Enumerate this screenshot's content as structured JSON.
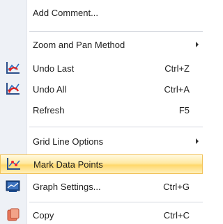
{
  "menu": {
    "items": [
      {
        "label": "Add Comment...",
        "shortcut": "",
        "submenu": false,
        "icon": ""
      },
      {
        "label": "Zoom and Pan Method",
        "shortcut": "",
        "submenu": true,
        "icon": ""
      },
      {
        "label": "Undo Last",
        "shortcut": "Ctrl+Z",
        "submenu": false,
        "icon": "undo-last-icon"
      },
      {
        "label": "Undo All",
        "shortcut": "Ctrl+A",
        "submenu": false,
        "icon": "undo-all-icon"
      },
      {
        "label": "Refresh",
        "shortcut": "F5",
        "submenu": false,
        "icon": ""
      },
      {
        "label": "Grid Line Options",
        "shortcut": "",
        "submenu": true,
        "icon": ""
      },
      {
        "label": "Mark Data Points",
        "shortcut": "",
        "submenu": false,
        "icon": "mark-data-points-icon",
        "highlighted": true
      },
      {
        "label": "Graph Settings...",
        "shortcut": "Ctrl+G",
        "submenu": false,
        "icon": "graph-settings-icon"
      },
      {
        "label": "Copy",
        "shortcut": "Ctrl+C",
        "submenu": false,
        "icon": "copy-icon"
      }
    ]
  },
  "colors": {
    "gutter": "#eef1f6",
    "highlight": "#ffe08a",
    "highlight_border": "#f2c35c",
    "separator": "#d3d7de"
  }
}
